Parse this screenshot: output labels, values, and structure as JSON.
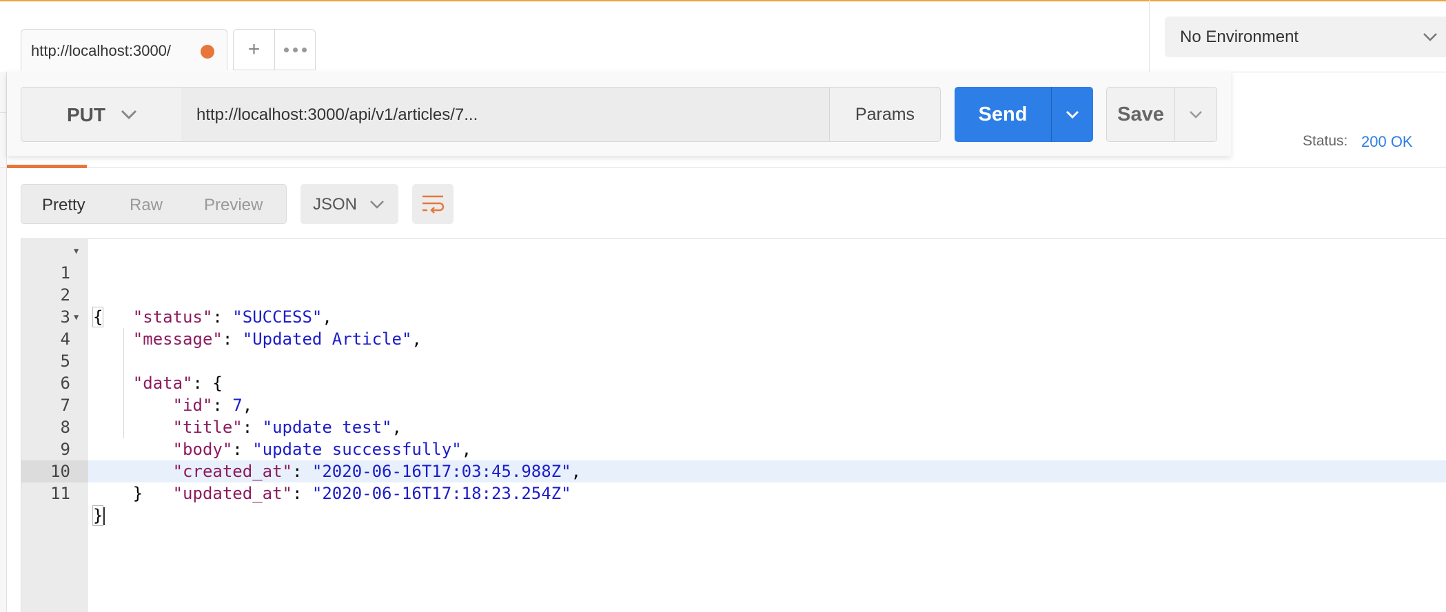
{
  "tab": {
    "title": "http://localhost:3000/",
    "unsaved_color": "#e8763a"
  },
  "tab_actions": {
    "new_tab": "+",
    "more": "more-options-icon"
  },
  "environment": {
    "selected": "No Environment"
  },
  "request": {
    "method": "PUT",
    "url": "http://localhost:3000/api/v1/articles/7...",
    "params_label": "Params",
    "send_label": "Send",
    "save_label": "Save"
  },
  "response": {
    "status_label": "Status:",
    "status_value": "200 OK",
    "views": [
      "Pretty",
      "Raw",
      "Preview"
    ],
    "active_view": "Pretty",
    "format": "JSON",
    "wrap_icon": "wrap-lines-icon"
  },
  "code": {
    "line_numbers": [
      "1",
      "2",
      "3",
      "4",
      "5",
      "6",
      "7",
      "8",
      "9",
      "10",
      "11"
    ],
    "open_brace": "{",
    "close_brace": "}",
    "status_key": "\"status\"",
    "status_value": "\"SUCCESS\"",
    "message_key": "\"message\"",
    "message_value": "\"Updated Article\"",
    "data_key": "\"data\"",
    "id_key": "\"id\"",
    "id_value": "7",
    "title_key": "\"title\"",
    "title_value": "\"update test\"",
    "body_key": "\"body\"",
    "body_value": "\"update successfully\"",
    "created_key": "\"created_at\"",
    "created_value": "\"2020-06-16T17:03:45.988Z\"",
    "updated_key": "\"updated_at\"",
    "updated_value": "\"2020-06-16T17:18:23.254Z\""
  },
  "colors": {
    "accent_orange": "#e8763a",
    "send_blue": "#2d7ee6",
    "json_key": "#8c1b5d",
    "json_value": "#1c1cc8"
  }
}
